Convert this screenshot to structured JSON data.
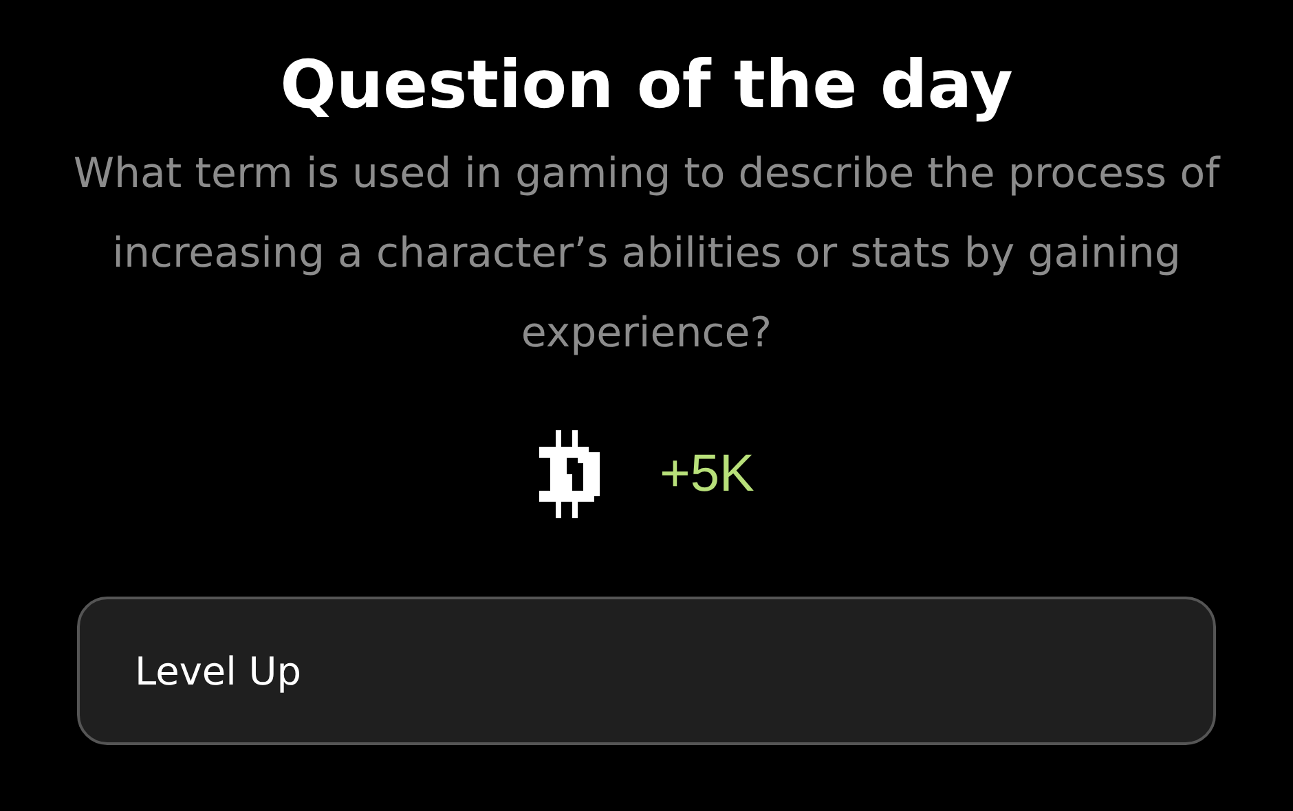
{
  "title": "Question of the day",
  "question": "What term is used in gaming to describe the process of increasing a character’s abilities or stats by gaining experience?",
  "reward": {
    "amount": "+5K"
  },
  "answer": {
    "value": "Level Up"
  }
}
